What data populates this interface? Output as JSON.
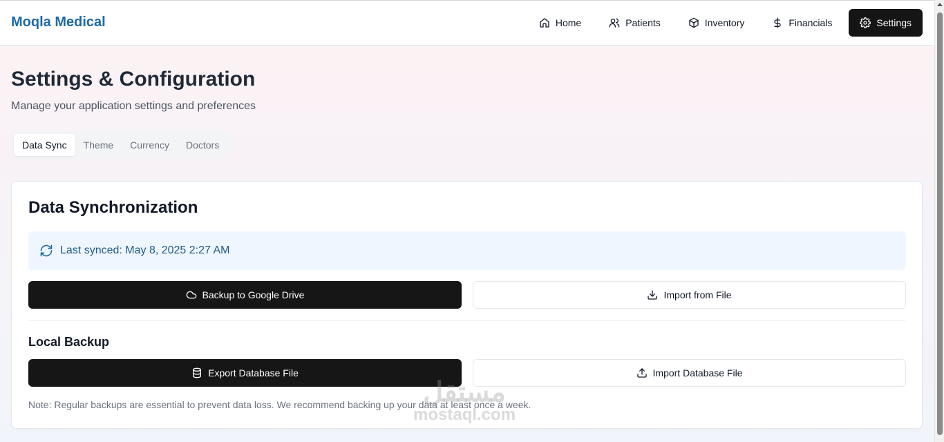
{
  "brand": "Moqla Medical",
  "nav": [
    {
      "label": "Home",
      "icon": "home-icon"
    },
    {
      "label": "Patients",
      "icon": "users-icon"
    },
    {
      "label": "Inventory",
      "icon": "package-icon"
    },
    {
      "label": "Financials",
      "icon": "dollar-icon"
    },
    {
      "label": "Settings",
      "icon": "gear-icon",
      "active": true
    }
  ],
  "page": {
    "title": "Settings & Configuration",
    "subtitle": "Manage your application settings and preferences"
  },
  "tabs": [
    {
      "label": "Data Sync",
      "active": true
    },
    {
      "label": "Theme"
    },
    {
      "label": "Currency"
    },
    {
      "label": "Doctors"
    }
  ],
  "card": {
    "title": "Data Synchronization",
    "last_synced": "Last synced: May 8, 2025 2:27 AM",
    "backup_label": "Backup to Google Drive",
    "import_file_label": "Import from File",
    "local_backup_title": "Local Backup",
    "export_db_label": "Export Database File",
    "import_db_label": "Import Database File",
    "note": "Note: Regular backups are essential to prevent data loss. We recommend backing up your data at least once a week."
  },
  "watermark": {
    "arabic": "مستقل",
    "latin": "mostaql.com"
  },
  "colors": {
    "brand": "#1e6aa8",
    "dark_button": "#161616",
    "sync_bg": "#eff6ff",
    "sync_text": "#1e5a8a"
  }
}
